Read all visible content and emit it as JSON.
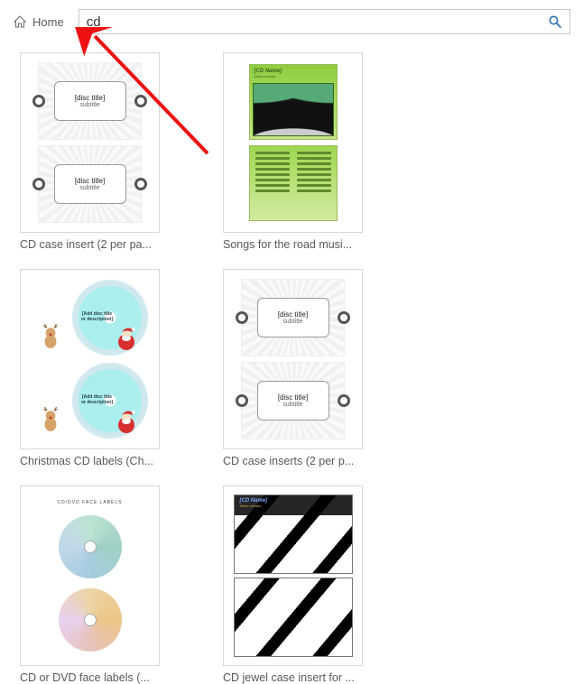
{
  "header": {
    "home_label": "Home"
  },
  "search": {
    "value": "cd",
    "placeholder": ""
  },
  "templates": [
    {
      "caption": "CD case insert (2 per pa...",
      "disc_title": "[disc title]"
    },
    {
      "caption": "Songs for the road musi...",
      "cd_name": "[CD Name]"
    },
    {
      "caption": "Christmas CD labels (Ch...",
      "label_text": "[Add disc title or description]"
    },
    {
      "caption": "CD case inserts (2 per p...",
      "disc_title": "[disc title]"
    },
    {
      "caption": "CD or DVD face labels (...",
      "header_text": "CD/DVD FACE LABELS"
    },
    {
      "caption": "CD jewel case insert for ...",
      "cd_name": "[CD Name]"
    }
  ]
}
